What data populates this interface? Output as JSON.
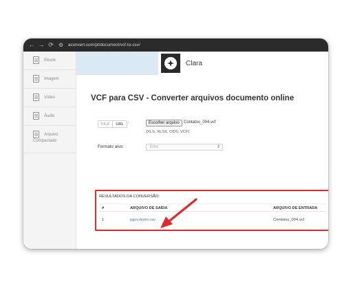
{
  "browser": {
    "back_icon": "arrow-left-icon",
    "forward_icon": "arrow-right-icon",
    "reload_icon": "reload-icon",
    "url": "aconvert.com/pt/document/vcf-to-csv/"
  },
  "sidebar": {
    "items": [
      {
        "label": "Ebook",
        "icon": "ebook-icon"
      },
      {
        "label": "Imagem",
        "icon": "image-icon"
      },
      {
        "label": "Vídeo",
        "icon": "video-icon"
      },
      {
        "label": "Áudio",
        "icon": "audio-icon"
      },
      {
        "label_line1": "Arquivo",
        "label_line2": "Compactado",
        "icon": "archive-icon"
      }
    ]
  },
  "ad": {
    "name": "Clara"
  },
  "page": {
    "title": "VCF para CSV - Converter arquivos documento online"
  },
  "upload": {
    "toggle_file": "FILE",
    "toggle_url": "URL",
    "colon": ":",
    "choose_button": "Escolher arquivo",
    "file_name": "Contatos_004.vcf",
    "formats_hint": "(XLS, XLSX, ODS, VCF)"
  },
  "target": {
    "label": "Formato alvo:",
    "value": "CSV",
    "arrow": "⇕"
  },
  "results": {
    "title": "RESULTADOS DA CONVERSÃO:",
    "columns": [
      "#",
      "ARQUIVO DE SAÍDA",
      "ARQUIVO DE ENTRADA"
    ],
    "rows": [
      {
        "index": "1",
        "output": "pgcv-bytm.csv",
        "input": "Contatos_004.vcf"
      }
    ]
  },
  "colors": {
    "highlight": "#e0282d",
    "link": "#3b73b9",
    "ad_background": "#dbe9f4"
  }
}
